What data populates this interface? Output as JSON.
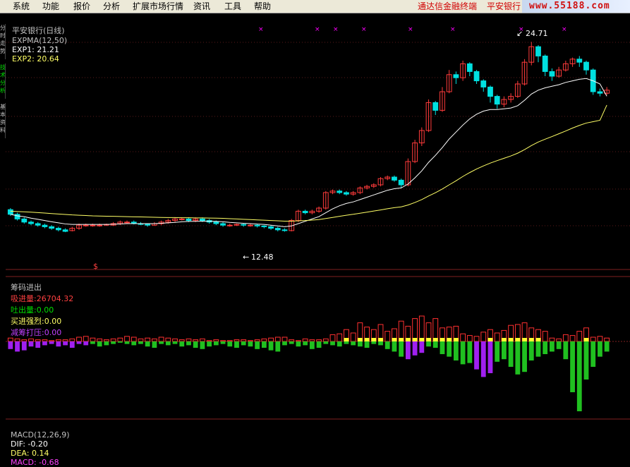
{
  "menu": {
    "items": [
      "系统",
      "功能",
      "报价",
      "分析",
      "扩展市场行情",
      "资讯",
      "工具",
      "帮助"
    ],
    "app_title": "通达信金融终端",
    "stock_name": "平安银行"
  },
  "logo_text": "www.55188.com",
  "sidebar_tabs": [
    "分时走势",
    "技术分析",
    "基本资料"
  ],
  "main_panel": {
    "header_title": "平安银行(日线)",
    "indicator_name": "EXPMA(12,50)",
    "exp1_label": "EXP1: 21.21",
    "exp2_label": "EXP2: 20.64",
    "high_label": "24.71",
    "low_label": "12.48",
    "colors": {
      "up": "#ff3b3b",
      "down": "#00e0e0",
      "exp1": "#ffffff",
      "exp2": "#ffff66",
      "marker": "#ff00ff"
    }
  },
  "volume_panel": {
    "title": "筹码进出",
    "absorb_label": "吸进量:",
    "absorb_value": "26704.32",
    "release_label": "吐出量:",
    "release_value": "0.00",
    "buy_label": "买进强烈:",
    "buy_value": "0.00",
    "reduce_label": "减筹打压:",
    "reduce_value": "0.00"
  },
  "macd_panel": {
    "title": "MACD(12,26,9)",
    "dif_label": "DIF: -0.20",
    "dea_label": "DEA: 0.14",
    "macd_label": "MACD: -0.68"
  },
  "price_axis": {
    "min": 10.5,
    "max": 25.5
  },
  "candles": [
    [
      13.9,
      13.6,
      14.0,
      13.5
    ],
    [
      13.6,
      13.3,
      13.7,
      13.2
    ],
    [
      13.3,
      13.1,
      13.4,
      13.0
    ],
    [
      13.1,
      13.0,
      13.2,
      12.9
    ],
    [
      13.0,
      12.9,
      13.1,
      12.8
    ],
    [
      12.9,
      12.8,
      13.0,
      12.7
    ],
    [
      12.8,
      12.7,
      12.9,
      12.6
    ],
    [
      12.7,
      12.6,
      12.8,
      12.5
    ],
    [
      12.6,
      12.5,
      12.7,
      12.45
    ],
    [
      12.55,
      12.7,
      12.8,
      12.5
    ],
    [
      12.7,
      12.9,
      13.0,
      12.6
    ],
    [
      12.9,
      12.9,
      13.0,
      12.8
    ],
    [
      12.9,
      12.9,
      13.0,
      12.8
    ],
    [
      12.9,
      12.9,
      13.0,
      12.8
    ],
    [
      12.9,
      12.95,
      13.0,
      12.85
    ],
    [
      12.9,
      13.0,
      13.1,
      12.85
    ],
    [
      13.0,
      13.1,
      13.2,
      12.9
    ],
    [
      13.1,
      13.1,
      13.2,
      13.0
    ],
    [
      13.1,
      13.0,
      13.2,
      12.95
    ],
    [
      13.0,
      12.95,
      13.1,
      12.9
    ],
    [
      12.95,
      12.9,
      13.0,
      12.8
    ],
    [
      12.9,
      13.0,
      13.1,
      12.85
    ],
    [
      13.0,
      13.1,
      13.2,
      12.9
    ],
    [
      13.1,
      13.2,
      13.3,
      13.0
    ],
    [
      13.2,
      13.3,
      13.4,
      13.1
    ],
    [
      13.3,
      13.3,
      13.4,
      13.2
    ],
    [
      13.3,
      13.2,
      13.4,
      13.1
    ],
    [
      13.2,
      13.3,
      13.4,
      13.1
    ],
    [
      13.3,
      13.2,
      13.4,
      13.1
    ],
    [
      13.2,
      13.1,
      13.3,
      13.0
    ],
    [
      13.1,
      13.0,
      13.2,
      12.9
    ],
    [
      13.0,
      12.9,
      13.1,
      12.8
    ],
    [
      12.9,
      12.9,
      13.0,
      12.8
    ],
    [
      12.9,
      12.95,
      13.0,
      12.85
    ],
    [
      12.95,
      12.9,
      13.0,
      12.8
    ],
    [
      12.9,
      12.9,
      13.0,
      12.8
    ],
    [
      12.9,
      12.85,
      13.0,
      12.75
    ],
    [
      12.85,
      12.8,
      12.9,
      12.7
    ],
    [
      12.8,
      12.7,
      12.9,
      12.6
    ],
    [
      12.7,
      12.6,
      12.8,
      12.5
    ],
    [
      12.6,
      12.55,
      12.7,
      12.48
    ],
    [
      12.55,
      13.2,
      13.3,
      12.5
    ],
    [
      13.2,
      13.8,
      13.9,
      13.1
    ],
    [
      13.8,
      13.7,
      13.9,
      13.6
    ],
    [
      13.7,
      13.8,
      13.9,
      13.6
    ],
    [
      13.8,
      14.0,
      14.1,
      13.7
    ],
    [
      14.0,
      15.0,
      15.1,
      13.9
    ],
    [
      15.0,
      15.1,
      15.2,
      14.9
    ],
    [
      15.1,
      15.0,
      15.2,
      14.9
    ],
    [
      15.0,
      14.9,
      15.1,
      14.8
    ],
    [
      14.9,
      15.0,
      15.1,
      14.8
    ],
    [
      15.0,
      15.3,
      15.4,
      14.9
    ],
    [
      15.3,
      15.4,
      15.5,
      15.2
    ],
    [
      15.4,
      15.5,
      15.6,
      15.3
    ],
    [
      15.5,
      15.9,
      16.0,
      15.4
    ],
    [
      15.9,
      16.0,
      16.1,
      15.8
    ],
    [
      16.0,
      15.8,
      16.1,
      15.7
    ],
    [
      15.8,
      15.5,
      15.9,
      15.3
    ],
    [
      15.5,
      17.0,
      17.2,
      15.4
    ],
    [
      17.0,
      18.2,
      18.4,
      16.9
    ],
    [
      18.2,
      19.0,
      19.2,
      18.0
    ],
    [
      19.0,
      20.8,
      21.0,
      18.9
    ],
    [
      20.8,
      20.3,
      20.9,
      20.0
    ],
    [
      20.3,
      21.5,
      21.8,
      20.2
    ],
    [
      21.5,
      22.6,
      22.9,
      21.4
    ],
    [
      22.6,
      22.4,
      22.8,
      22.0
    ],
    [
      22.4,
      23.3,
      23.5,
      22.2
    ],
    [
      23.3,
      22.8,
      23.4,
      22.5
    ],
    [
      22.8,
      22.2,
      22.9,
      22.0
    ],
    [
      22.2,
      21.8,
      22.3,
      21.5
    ],
    [
      21.8,
      21.2,
      21.9,
      20.8
    ],
    [
      21.2,
      20.7,
      21.3,
      20.4
    ],
    [
      20.7,
      21.0,
      21.2,
      20.5
    ],
    [
      21.0,
      21.2,
      21.4,
      20.8
    ],
    [
      21.2,
      22.0,
      22.2,
      21.1
    ],
    [
      22.0,
      23.4,
      23.6,
      21.9
    ],
    [
      23.4,
      24.4,
      24.71,
      23.2
    ],
    [
      24.4,
      23.8,
      24.5,
      23.4
    ],
    [
      23.8,
      22.8,
      23.9,
      22.5
    ],
    [
      22.8,
      22.5,
      23.0,
      22.2
    ],
    [
      22.5,
      22.9,
      23.1,
      22.4
    ],
    [
      22.9,
      23.3,
      23.5,
      22.8
    ],
    [
      23.3,
      23.6,
      23.7,
      23.1
    ],
    [
      23.6,
      23.4,
      23.8,
      23.1
    ],
    [
      23.4,
      22.9,
      23.5,
      22.6
    ],
    [
      22.9,
      21.5,
      23.0,
      21.3
    ],
    [
      21.5,
      21.4,
      21.7,
      21.2
    ],
    [
      21.4,
      21.6,
      21.8,
      21.3
    ]
  ],
  "exp_lines": {
    "exp1": [
      13.6,
      13.5,
      13.45,
      13.35,
      13.28,
      13.2,
      13.12,
      13.05,
      12.98,
      12.95,
      12.95,
      12.95,
      12.95,
      12.95,
      12.95,
      12.96,
      12.98,
      13.0,
      13.0,
      13.0,
      13.0,
      13.0,
      13.02,
      13.05,
      13.08,
      13.12,
      13.14,
      13.15,
      13.16,
      13.16,
      13.14,
      13.12,
      13.08,
      13.05,
      13.02,
      13.0,
      12.97,
      12.95,
      12.9,
      12.85,
      12.8,
      12.85,
      13.0,
      13.15,
      13.3,
      13.45,
      13.7,
      13.95,
      14.15,
      14.3,
      14.4,
      14.55,
      14.7,
      14.85,
      15.0,
      15.15,
      15.25,
      15.3,
      15.55,
      15.95,
      16.4,
      16.95,
      17.4,
      17.9,
      18.45,
      18.9,
      19.35,
      19.75,
      20.05,
      20.25,
      20.35,
      20.35,
      20.4,
      20.45,
      20.6,
      20.95,
      21.35,
      21.6,
      21.75,
      21.85,
      21.95,
      22.1,
      22.2,
      22.3,
      22.35,
      22.2,
      22.0,
      21.21
    ],
    "exp2": [
      13.8,
      13.78,
      13.76,
      13.74,
      13.71,
      13.68,
      13.65,
      13.62,
      13.59,
      13.56,
      13.54,
      13.52,
      13.5,
      13.49,
      13.48,
      13.47,
      13.46,
      13.45,
      13.44,
      13.43,
      13.42,
      13.41,
      13.4,
      13.39,
      13.39,
      13.38,
      13.38,
      13.37,
      13.37,
      13.36,
      13.35,
      13.34,
      13.32,
      13.3,
      13.28,
      13.26,
      13.24,
      13.22,
      13.2,
      13.18,
      13.16,
      13.16,
      13.18,
      13.2,
      13.23,
      13.26,
      13.33,
      13.4,
      13.47,
      13.54,
      13.6,
      13.67,
      13.74,
      13.81,
      13.88,
      13.96,
      14.03,
      14.08,
      14.2,
      14.36,
      14.55,
      14.78,
      14.99,
      15.23,
      15.5,
      15.76,
      16.04,
      16.29,
      16.52,
      16.72,
      16.9,
      17.06,
      17.21,
      17.36,
      17.54,
      17.77,
      18.03,
      18.26,
      18.44,
      18.61,
      18.79,
      18.97,
      19.16,
      19.33,
      19.48,
      19.57,
      19.66,
      20.64
    ]
  },
  "vol_bars": {
    "up": [
      4,
      3,
      2,
      3,
      2,
      2,
      1,
      2,
      2,
      3,
      5,
      6,
      4,
      3,
      2,
      3,
      4,
      6,
      5,
      3,
      4,
      3,
      5,
      4,
      3,
      2,
      3,
      2,
      3,
      1,
      2,
      1,
      1,
      2,
      2,
      1,
      2,
      3,
      4,
      5,
      5,
      2,
      1,
      3,
      2,
      2,
      3,
      8,
      9,
      14,
      10,
      22,
      17,
      14,
      20,
      12,
      15,
      24,
      18,
      27,
      30,
      22,
      27,
      16,
      17,
      18,
      9,
      7,
      6,
      11,
      14,
      10,
      13,
      19,
      20,
      22,
      16,
      14,
      12,
      4,
      3,
      8,
      7,
      12,
      16,
      5,
      6,
      4
    ],
    "neg": [
      -6,
      -8,
      -7,
      -4,
      -5,
      -3,
      -2,
      -4,
      -3,
      -5,
      -2,
      -3,
      -2,
      -4,
      -3,
      -2,
      -1,
      -2,
      -3,
      -2,
      -4,
      -5,
      -2,
      -3,
      -2,
      -4,
      -3,
      -5,
      -6,
      -4,
      -3,
      -2,
      -4,
      -5,
      -3,
      -4,
      -6,
      -5,
      -7,
      -8,
      -3,
      -2,
      -4,
      -3,
      -6,
      -5,
      -2,
      -3,
      -4,
      -2,
      -3,
      -4,
      -5,
      -2,
      -3,
      -6,
      -8,
      -12,
      -14,
      -11,
      -9,
      -4,
      -5,
      -10,
      -12,
      -15,
      -18,
      -17,
      -22,
      -28,
      -25,
      -16,
      -14,
      -20,
      -26,
      -24,
      -15,
      -12,
      -10,
      -8,
      -6,
      -14,
      -40,
      -55,
      -30,
      -20,
      -12,
      -8
    ]
  }
}
